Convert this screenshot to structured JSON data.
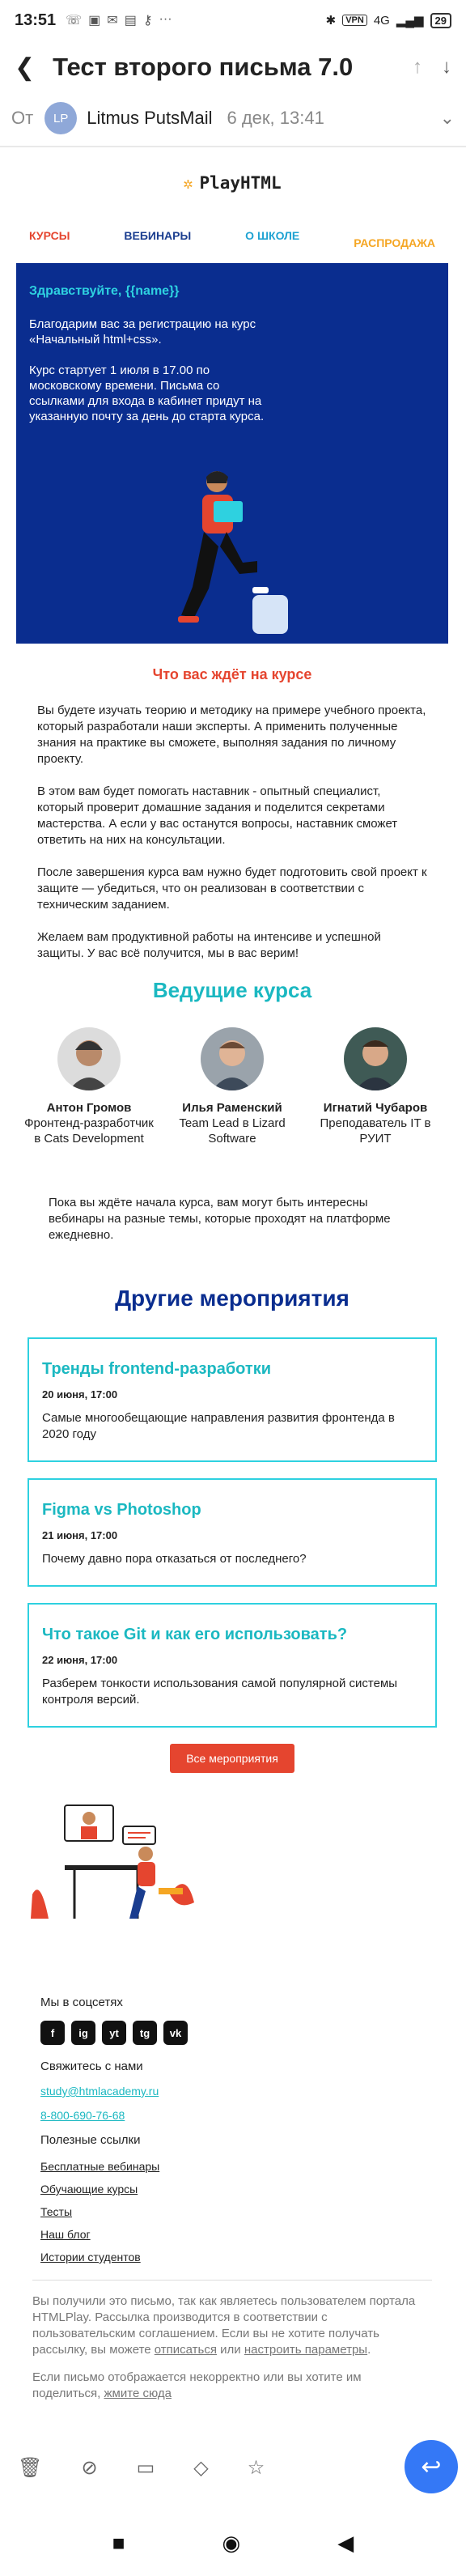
{
  "status": {
    "time": "13:51",
    "left_icons": [
      "wifi-call-icon",
      "media-icon",
      "mail-icon",
      "ticket-icon",
      "key-icon",
      "more-dots-icon"
    ],
    "vpn": "VPN",
    "network": "4G",
    "battery": "29"
  },
  "header": {
    "subject": "Тест второго письма 7.0"
  },
  "from": {
    "label": "От",
    "initials": "LP",
    "name": "Litmus PutsMail",
    "date": "6 дек, 13:41"
  },
  "email": {
    "logo": "PlayHTML",
    "nav": [
      "КУРСЫ",
      "ВЕБИНАРЫ",
      "О ШКОЛЕ",
      "РАСПРОДАЖА"
    ],
    "hero": {
      "greeting": "Здравствуйте, {{name}}",
      "p1": "Благодарим вас за регистрацию на курс «Начальный html+css».",
      "p2": "Курс стартует 1 июля в 17.00 по московскому времени. Письма со ссылками для входа в кабинет придут на указанную почту за день до старта курса."
    },
    "expect_title": "Что вас ждёт на курсе",
    "paragraphs": [
      "Вы будете изучать теорию и методику на примере учебного проекта, который разработали наши эксперты. А применить полученные знания на практике вы сможете, выполняя задания по личному проекту.",
      "В этом вам будет помогать наставник - опытный специалист, который проверит домашние задания и поделится секретами мастерства. А если у вас останутся вопросы, наставник сможет ответить на них на консультации.",
      "После завершения курса вам нужно будет подготовить свой проект к защите — убедиться, что он реализован в соответствии с техническим заданием.",
      "Желаем вам продуктивной работы на интенсиве и успешной защиты. У вас всё получится, мы в вас верим!"
    ],
    "teachers_title": "Ведущие курса",
    "teachers": [
      {
        "name": "Антон Громов",
        "role": "Фронтенд-разработчик в Cats Development"
      },
      {
        "name": "Илья Раменский",
        "role": "Team Lead в Lizard Software"
      },
      {
        "name": "Игнатий Чубаров",
        "role": "Преподаватель IT в РУИТ"
      }
    ],
    "intro": "Пока вы ждёте начала курса, вам могут быть интересны вебинары на разные темы, которые проходят на платформе ежедневно.",
    "events_title": "Другие мероприятия",
    "events": [
      {
        "title": "Тренды frontend-разработки",
        "date": "20 июня, 17:00",
        "desc": "Самые многообещающие направления развития фронтенда в 2020 году"
      },
      {
        "title": "Figma vs Photoshop",
        "date": "21 июня, 17:00",
        "desc": "Почему давно пора отказаться от последнего?"
      },
      {
        "title": "Что такое Git и как его использовать?",
        "date": "22 июня, 17:00",
        "desc": "Разберем тонкости использования самой популярной системы контроля версий."
      }
    ],
    "all_events_button": "Все мероприятия",
    "footer": {
      "social_label": "Мы в соцсетях",
      "socials": [
        "f",
        "ig",
        "yt",
        "tg",
        "vk"
      ],
      "contact_label": "Свяжитесь с нами",
      "email": "study@htmlacademy.ru",
      "phone": "8-800-690-76-68",
      "useful_label": "Полезные ссылки",
      "links": [
        "Бесплатные вебинары",
        "Обучающие курсы",
        "Тесты",
        "Наш блог",
        "Истории студентов"
      ],
      "disclaimer1_a": "Вы получили это письмо, так как являетесь пользователем портала HTMLPlay. Рассылка производится в соответствии с пользовательским соглашением. Если вы не хотите получать рассылку, вы можете ",
      "unsubscribe": "отписаться",
      "disclaimer1_b": " или ",
      "settings": "настроить параметры",
      "disclaimer1_c": ".",
      "disclaimer2_a": "Если письмо отображается некорректно или вы хотите им поделиться, ",
      "view_here": "жмите сюда"
    }
  },
  "colors": {
    "hero_bg": "#0a2d8f",
    "accent_red": "#e5452f",
    "accent_teal": "#1bb8c1",
    "fab": "#3478f6"
  }
}
